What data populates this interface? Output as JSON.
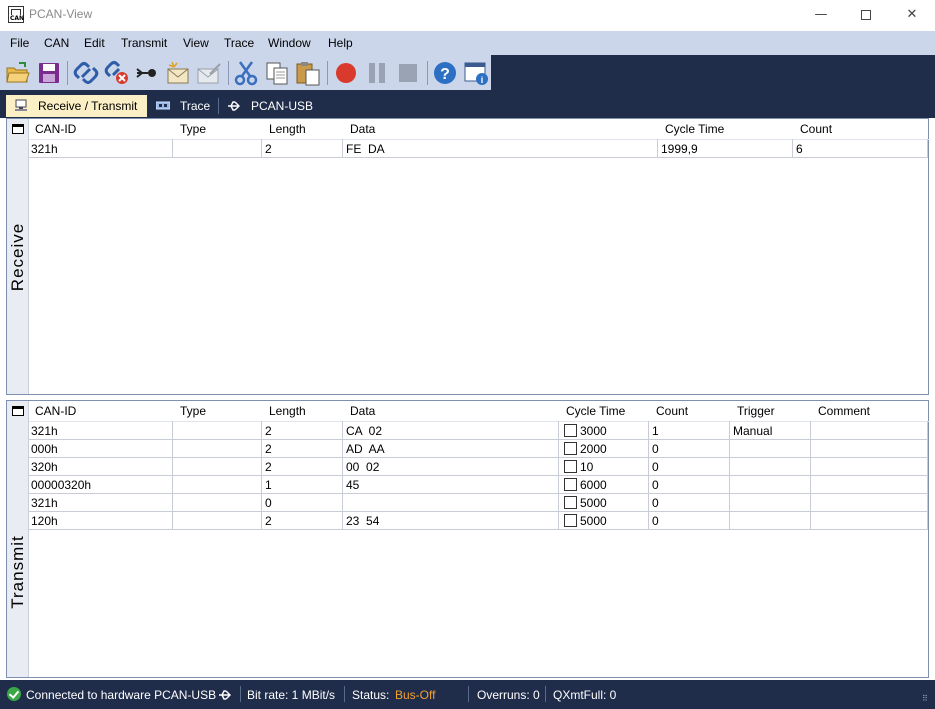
{
  "window": {
    "title": "PCAN-View",
    "minimize": "—",
    "close": "✕",
    "icon_text": "CAN"
  },
  "menu": [
    "File",
    "CAN",
    "Edit",
    "Transmit",
    "View",
    "Trace",
    "Window",
    "Help"
  ],
  "toolbar": [
    "open-icon",
    "save-icon",
    "connect-icon",
    "disconnect-icon",
    "reset-icon",
    "new-message-icon",
    "edit-message-icon",
    "cut-icon",
    "copy-icon",
    "paste-icon",
    "record-icon",
    "pause-icon",
    "stop-icon",
    "help-icon",
    "about-icon"
  ],
  "tabs": [
    {
      "label": "Receive / Transmit",
      "active": true
    },
    {
      "label": "Trace",
      "active": false
    },
    {
      "label": "PCAN-USB",
      "active": false
    }
  ],
  "receive": {
    "side_label": "Receive",
    "columns": [
      "CAN-ID",
      "Type",
      "Length",
      "Data",
      "Cycle Time",
      "Count"
    ],
    "rows": [
      {
        "can_id": "321h",
        "type": "",
        "length": "2",
        "data": "FE  DA",
        "cycle_time": "1999,9",
        "count": "6"
      }
    ]
  },
  "transmit": {
    "side_label": "Transmit",
    "columns": [
      "CAN-ID",
      "Type",
      "Length",
      "Data",
      "Cycle Time",
      "Count",
      "Trigger",
      "Comment"
    ],
    "rows": [
      {
        "can_id": "321h",
        "type": "",
        "length": "2",
        "data": "CA  02",
        "cycle_time": "3000",
        "count": "1",
        "trigger": "Manual",
        "comment": ""
      },
      {
        "can_id": "000h",
        "type": "",
        "length": "2",
        "data": "AD  AA",
        "cycle_time": "2000",
        "count": "0",
        "trigger": "",
        "comment": ""
      },
      {
        "can_id": "320h",
        "type": "",
        "length": "2",
        "data": "00  02",
        "cycle_time": "10",
        "count": "0",
        "trigger": "",
        "comment": ""
      },
      {
        "can_id": "00000320h",
        "type": "",
        "length": "1",
        "data": "45",
        "cycle_time": "6000",
        "count": "0",
        "trigger": "",
        "comment": ""
      },
      {
        "can_id": "321h",
        "type": "",
        "length": "0",
        "data": "",
        "cycle_time": "5000",
        "count": "0",
        "trigger": "",
        "comment": ""
      },
      {
        "can_id": "120h",
        "type": "",
        "length": "2",
        "data": "23  54",
        "cycle_time": "5000",
        "count": "0",
        "trigger": "",
        "comment": ""
      }
    ]
  },
  "status": {
    "connection": "Connected to hardware PCAN-USB",
    "bitrate": "Bit rate: 1 MBit/s",
    "status_label": "Status:",
    "status_value": "Bus-Off",
    "overruns": "Overruns: 0",
    "qxmtfull": "QXmtFull: 0"
  },
  "colors": {
    "chrome_dark": "#1f2c4a",
    "menu_bg": "#cbd6ea",
    "tab_active": "#fbefc6",
    "bus_off": "#f0a030",
    "record_red": "#d93a2b",
    "ok_green": "#3aa845"
  }
}
